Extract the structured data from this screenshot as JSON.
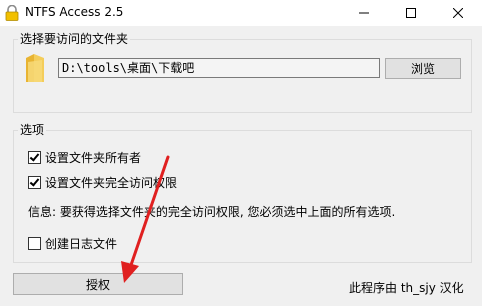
{
  "window": {
    "title": "NTFS Access 2.5",
    "icon": "padlock-icon"
  },
  "folder_group": {
    "label": "选择要访问的文件夹",
    "path_value": "D:\\tools\\桌面\\下载吧",
    "browse_label": "浏览",
    "icon": "folder-icon"
  },
  "options_group": {
    "label": "选项",
    "set_owner": {
      "label": "设置文件夹所有者",
      "checked": true
    },
    "full_access": {
      "label": "设置文件夹完全访问权限",
      "checked": true
    },
    "info": "信息: 要获得选择文件夹的完全访问权限, 您必须选中上面的所有选项.",
    "create_log": {
      "label": "创建日志文件",
      "checked": false
    }
  },
  "footer": {
    "authorize_label": "授权",
    "credit": "此程序由 th_sjy 汉化"
  },
  "annotation": {
    "arrow_color": "#e02020"
  }
}
